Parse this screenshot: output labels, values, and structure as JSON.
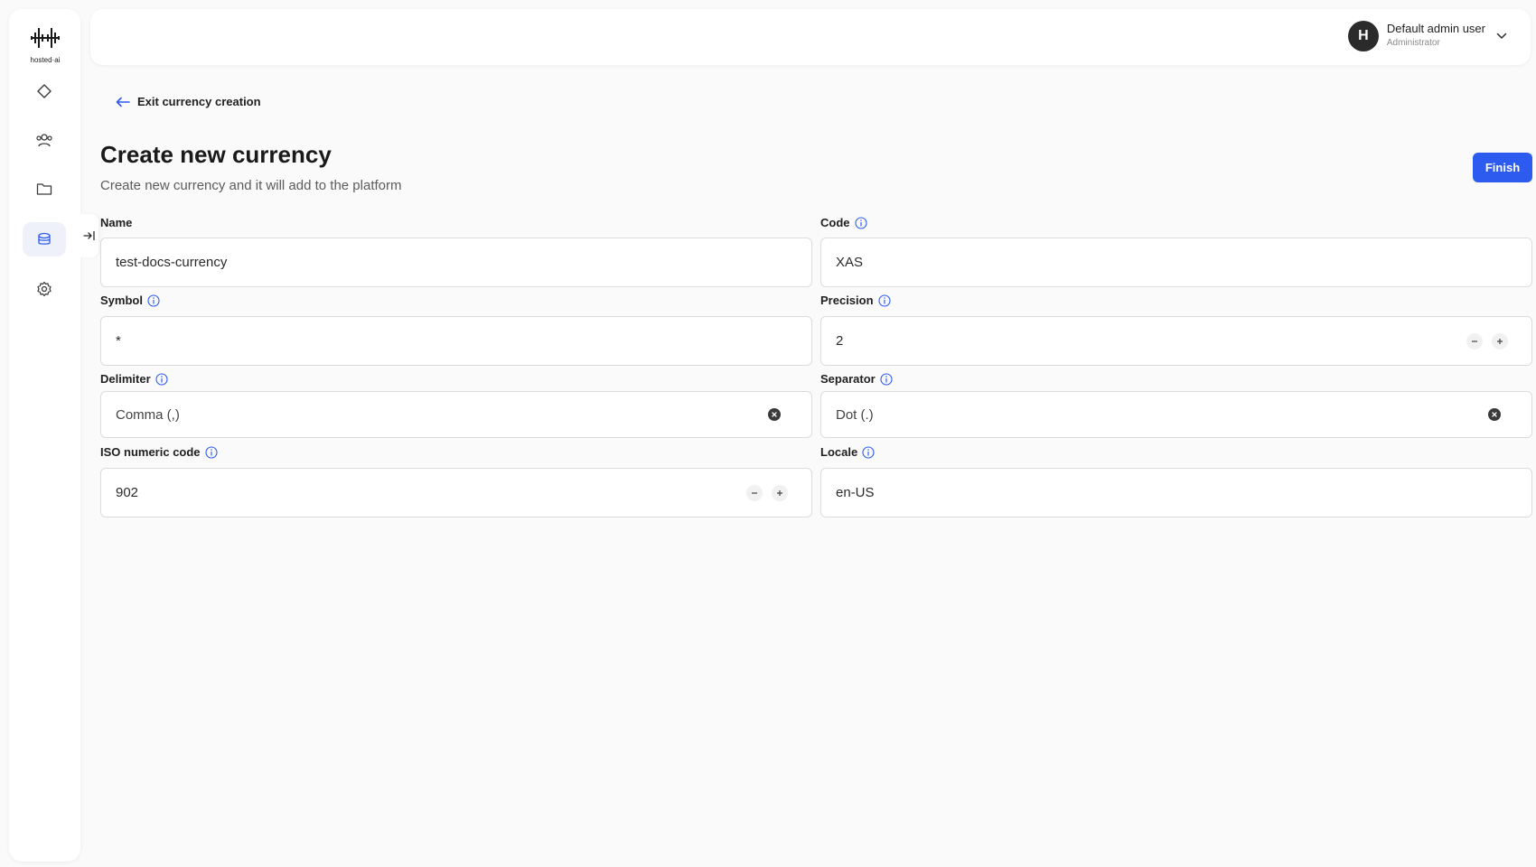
{
  "logo": {
    "text": "hosted·ai"
  },
  "sidebar": {
    "items": [
      {
        "icon": "diamond-icon"
      },
      {
        "icon": "users-icon"
      },
      {
        "icon": "folder-icon"
      },
      {
        "icon": "coins-icon",
        "active": true
      },
      {
        "icon": "gear-icon"
      }
    ]
  },
  "user": {
    "initial": "H",
    "name": "Default admin user",
    "role": "Administrator"
  },
  "back": {
    "label": "Exit currency creation"
  },
  "page": {
    "title": "Create new currency",
    "subtitle": "Create new currency and it will add to the platform",
    "finish_label": "Finish"
  },
  "form": {
    "name": {
      "label": "Name",
      "value": "test-docs-currency"
    },
    "code": {
      "label": "Code",
      "value": "XAS"
    },
    "symbol": {
      "label": "Symbol",
      "value": "*"
    },
    "precision": {
      "label": "Precision",
      "value": "2"
    },
    "delimiter": {
      "label": "Delimiter",
      "value": "Comma (,)"
    },
    "separator": {
      "label": "Separator",
      "value": "Dot (.)"
    },
    "iso": {
      "label": "ISO numeric code",
      "value": "902"
    },
    "locale": {
      "label": "Locale",
      "value": "en-US"
    }
  },
  "colors": {
    "accent": "#2d5bf0",
    "info": "#2d5bf0"
  }
}
